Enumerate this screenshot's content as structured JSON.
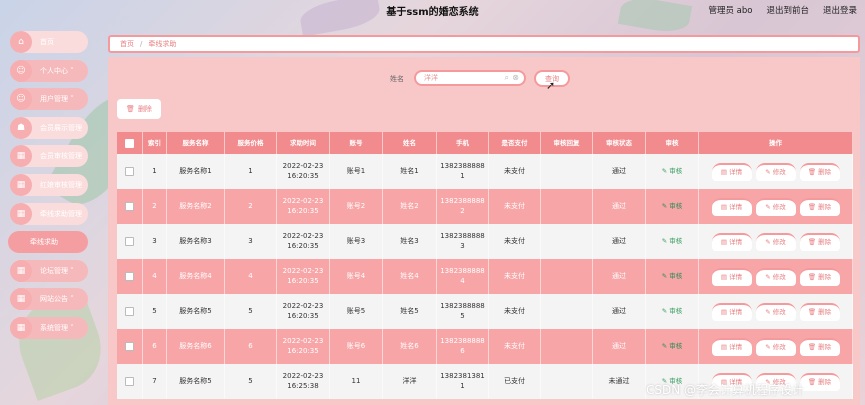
{
  "app": {
    "title": "基于ssm的婚恋系统"
  },
  "top_links": [
    {
      "label": "管理员 abo"
    },
    {
      "label": "退出到前台"
    },
    {
      "label": "退出登录"
    }
  ],
  "sidebar": {
    "items": [
      {
        "label": "首页",
        "type": "item"
      },
      {
        "label": "个人中心 ˅",
        "type": "group"
      },
      {
        "label": "用户管理 ˅",
        "type": "group"
      },
      {
        "label": "会员展示管理",
        "type": "item"
      },
      {
        "label": "会员审核管理",
        "type": "item"
      },
      {
        "label": "红娘审核管理",
        "type": "item"
      },
      {
        "label": "牵线求助管理",
        "type": "item"
      },
      {
        "label": "牵线求助",
        "type": "sub"
      },
      {
        "label": "论坛管理 ˅",
        "type": "group"
      },
      {
        "label": "网站公告 ˅",
        "type": "group"
      },
      {
        "label": "系统管理 ˅",
        "type": "group"
      }
    ]
  },
  "breadcrumb": {
    "home": "首页",
    "separator": "/",
    "current": "牵线求助"
  },
  "search": {
    "label": "姓名",
    "value": "洋洋",
    "button": "查询"
  },
  "toolbar": {
    "delete_label": "删除"
  },
  "table": {
    "columns": [
      "索引",
      "服务名称",
      "服务价格",
      "求助时间",
      "账号",
      "姓名",
      "手机",
      "是否支付",
      "审核回复",
      "审核状态",
      "审核",
      "操作"
    ],
    "audit_label": "审核",
    "op_labels": {
      "detail": "详情",
      "edit": "修改",
      "delete": "删除"
    },
    "rows": [
      {
        "index": "1",
        "service": "服务名称1",
        "price": "1",
        "date": "2022-02-23",
        "time": "16:20:35",
        "account": "账号1",
        "name": "姓名1",
        "phone_a": "1382388888",
        "phone_b": "1",
        "paid": "未支付",
        "reply": "",
        "status": "通过"
      },
      {
        "index": "2",
        "service": "服务名称2",
        "price": "2",
        "date": "2022-02-23",
        "time": "16:20:35",
        "account": "账号2",
        "name": "姓名2",
        "phone_a": "1382388888",
        "phone_b": "2",
        "paid": "未支付",
        "reply": "",
        "status": "通过"
      },
      {
        "index": "3",
        "service": "服务名称3",
        "price": "3",
        "date": "2022-02-23",
        "time": "16:20:35",
        "account": "账号3",
        "name": "姓名3",
        "phone_a": "1382388888",
        "phone_b": "3",
        "paid": "未支付",
        "reply": "",
        "status": "通过"
      },
      {
        "index": "4",
        "service": "服务名称4",
        "price": "4",
        "date": "2022-02-23",
        "time": "16:20:35",
        "account": "账号4",
        "name": "姓名4",
        "phone_a": "1382388888",
        "phone_b": "4",
        "paid": "未支付",
        "reply": "",
        "status": "通过"
      },
      {
        "index": "5",
        "service": "服务名称5",
        "price": "5",
        "date": "2022-02-23",
        "time": "16:20:35",
        "account": "账号5",
        "name": "姓名5",
        "phone_a": "1382388888",
        "phone_b": "5",
        "paid": "未支付",
        "reply": "",
        "status": "通过"
      },
      {
        "index": "6",
        "service": "服务名称6",
        "price": "6",
        "date": "2022-02-23",
        "time": "16:20:35",
        "account": "账号6",
        "name": "姓名6",
        "phone_a": "1382388888",
        "phone_b": "6",
        "paid": "未支付",
        "reply": "",
        "status": "通过"
      },
      {
        "index": "7",
        "service": "服务名称5",
        "price": "5",
        "date": "2022-02-23",
        "time": "16:25:38",
        "account": "11",
        "name": "洋洋",
        "phone_a": "1382381381",
        "phone_b": "1",
        "paid": "已支付",
        "reply": "",
        "status": "未通过"
      }
    ]
  },
  "watermark": "CSDN @李会计算机程序设计",
  "colors": {
    "accent": "#f59a9c",
    "header": "#f28b8e",
    "row_alt": "#f7a5a7",
    "panel": "#f8c7c7",
    "audit_green": "#3b9e63"
  }
}
